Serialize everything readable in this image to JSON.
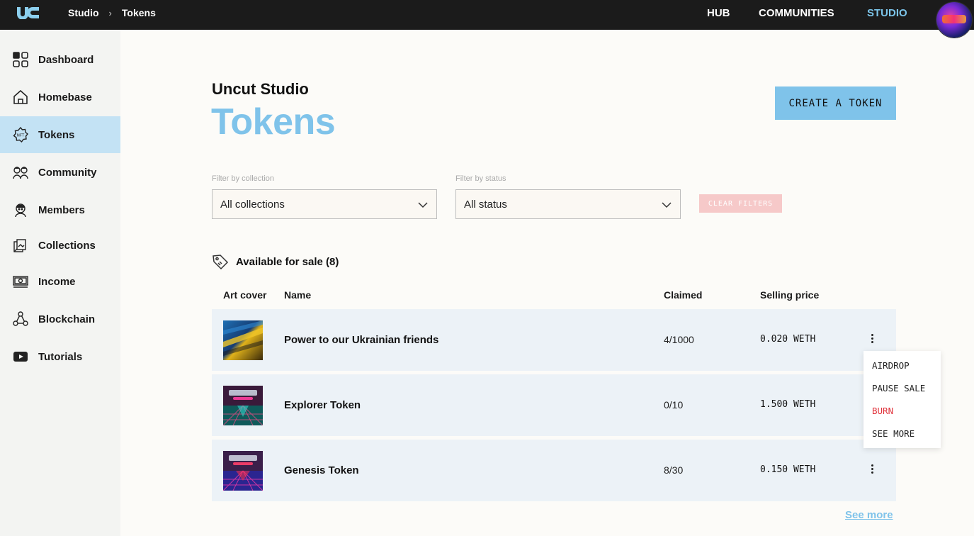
{
  "header": {
    "breadcrumbs": [
      "Studio",
      "Tokens"
    ],
    "nav": [
      "HUB",
      "COMMUNITIES",
      "STUDIO"
    ],
    "active_nav": "STUDIO",
    "accent": "#7cc5ea"
  },
  "sidebar": {
    "items": [
      {
        "label": "Dashboard",
        "icon": "dashboard-icon"
      },
      {
        "label": "Homebase",
        "icon": "home-icon"
      },
      {
        "label": "Tokens",
        "icon": "nft-badge-icon",
        "active": true
      },
      {
        "label": "Community",
        "icon": "community-icon"
      },
      {
        "label": "Members",
        "icon": "member-icon"
      },
      {
        "label": "Collections",
        "icon": "collections-icon"
      },
      {
        "label": "Income",
        "icon": "income-icon"
      },
      {
        "label": "Blockchain",
        "icon": "blockchain-icon"
      },
      {
        "label": "Tutorials",
        "icon": "play-icon"
      }
    ],
    "active_color": "#c3e2f4"
  },
  "page": {
    "subtitle": "Uncut Studio",
    "title": "Tokens",
    "create_button": "CREATE A TOKEN"
  },
  "filters": {
    "collection_label": "Filter by collection",
    "collection_value": "All collections",
    "status_label": "Filter by status",
    "status_value": "All status",
    "clear_button": "CLEAR FILTERS"
  },
  "section": {
    "title": "Available for sale (8)"
  },
  "table": {
    "columns": [
      "Art cover",
      "Name",
      "Claimed",
      "Selling price"
    ],
    "rows": [
      {
        "name": "Power to our Ukrainian friends",
        "claimed": "4/1000",
        "price": "0.020 WETH"
      },
      {
        "name": "Explorer Token",
        "claimed": "0/10",
        "price": "1.500 WETH"
      },
      {
        "name": "Genesis Token",
        "claimed": "8/30",
        "price": "0.150 WETH"
      }
    ]
  },
  "context_menu": {
    "items": [
      "AIRDROP",
      "PAUSE SALE",
      "BURN",
      "SEE MORE"
    ],
    "danger_color": "#e0313a"
  },
  "footer": {
    "see_more": "See more"
  }
}
